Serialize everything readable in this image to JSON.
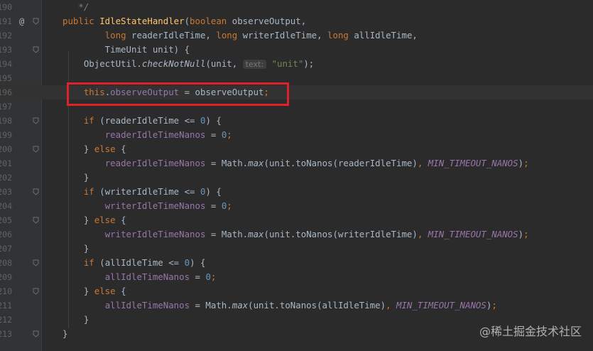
{
  "editor": {
    "lines": [
      {
        "n": "190",
        "code": [
          {
            "t": "   */",
            "c": "cmt"
          }
        ]
      },
      {
        "n": "191",
        "at": "@",
        "code": [
          {
            "t": "public ",
            "c": "kw"
          },
          {
            "t": "IdleStateHandler",
            "c": "fn"
          },
          {
            "t": "("
          },
          {
            "t": "boolean ",
            "c": "kw"
          },
          {
            "t": "observeOutput,"
          }
        ]
      },
      {
        "n": "192",
        "code": [
          {
            "t": "        "
          },
          {
            "t": "long ",
            "c": "kw"
          },
          {
            "t": "readerIdleTime, "
          },
          {
            "t": "long ",
            "c": "kw"
          },
          {
            "t": "writerIdleTime, "
          },
          {
            "t": "long ",
            "c": "kw"
          },
          {
            "t": "allIdleTime,"
          }
        ]
      },
      {
        "n": "193",
        "code": [
          {
            "t": "        TimeUnit unit) {"
          }
        ]
      },
      {
        "n": "194",
        "code": [
          {
            "t": "    ObjectUtil."
          },
          {
            "t": "checkNotNull",
            "c": "itc"
          },
          {
            "t": "(unit, "
          },
          {
            "t": "text:",
            "c": "hint"
          },
          {
            "t": " "
          },
          {
            "t": "\"unit\"",
            "c": "str"
          },
          {
            "t": ");"
          }
        ]
      },
      {
        "n": "195",
        "code": []
      },
      {
        "n": "196",
        "hl": true,
        "code": [
          {
            "t": "    "
          },
          {
            "t": "this",
            "c": "kw"
          },
          {
            "t": "."
          },
          {
            "t": "observeOutput",
            "c": "fld"
          },
          {
            "t": " = observeOutput"
          },
          {
            "t": ";",
            "c": "kw"
          }
        ]
      },
      {
        "n": "197",
        "code": []
      },
      {
        "n": "198",
        "code": [
          {
            "t": "    "
          },
          {
            "t": "if ",
            "c": "kw"
          },
          {
            "t": "(readerIdleTime <= "
          },
          {
            "t": "0",
            "c": "num"
          },
          {
            "t": ") {"
          }
        ]
      },
      {
        "n": "199",
        "code": [
          {
            "t": "        "
          },
          {
            "t": "readerIdleTimeNanos",
            "c": "fld"
          },
          {
            "t": " = "
          },
          {
            "t": "0",
            "c": "num"
          },
          {
            "t": ";",
            "c": "kw"
          }
        ]
      },
      {
        "n": "200",
        "code": [
          {
            "t": "    } "
          },
          {
            "t": "else ",
            "c": "kw"
          },
          {
            "t": "{"
          }
        ]
      },
      {
        "n": "201",
        "code": [
          {
            "t": "        "
          },
          {
            "t": "readerIdleTimeNanos",
            "c": "fld"
          },
          {
            "t": " = Math."
          },
          {
            "t": "max",
            "c": "itc"
          },
          {
            "t": "(unit.toNanos(readerIdleTime)"
          },
          {
            "t": ", ",
            "c": "kw"
          },
          {
            "t": "MIN_TIMEOUT_NANOS",
            "c": "cst"
          },
          {
            "t": ")"
          },
          {
            "t": ";",
            "c": "kw"
          }
        ]
      },
      {
        "n": "202",
        "code": [
          {
            "t": "    }"
          }
        ]
      },
      {
        "n": "203",
        "code": [
          {
            "t": "    "
          },
          {
            "t": "if ",
            "c": "kw"
          },
          {
            "t": "(writerIdleTime <= "
          },
          {
            "t": "0",
            "c": "num"
          },
          {
            "t": ") {"
          }
        ]
      },
      {
        "n": "204",
        "code": [
          {
            "t": "        "
          },
          {
            "t": "writerIdleTimeNanos",
            "c": "fld"
          },
          {
            "t": " = "
          },
          {
            "t": "0",
            "c": "num"
          },
          {
            "t": ";",
            "c": "kw"
          }
        ]
      },
      {
        "n": "205",
        "code": [
          {
            "t": "    } "
          },
          {
            "t": "else ",
            "c": "kw"
          },
          {
            "t": "{"
          }
        ]
      },
      {
        "n": "206",
        "code": [
          {
            "t": "        "
          },
          {
            "t": "writerIdleTimeNanos",
            "c": "fld"
          },
          {
            "t": " = Math."
          },
          {
            "t": "max",
            "c": "itc"
          },
          {
            "t": "(unit.toNanos(writerIdleTime)"
          },
          {
            "t": ", ",
            "c": "kw"
          },
          {
            "t": "MIN_TIMEOUT_NANOS",
            "c": "cst"
          },
          {
            "t": ")"
          },
          {
            "t": ";",
            "c": "kw"
          }
        ]
      },
      {
        "n": "207",
        "code": [
          {
            "t": "    }"
          }
        ]
      },
      {
        "n": "208",
        "code": [
          {
            "t": "    "
          },
          {
            "t": "if ",
            "c": "kw"
          },
          {
            "t": "(allIdleTime <= "
          },
          {
            "t": "0",
            "c": "num"
          },
          {
            "t": ") {"
          }
        ]
      },
      {
        "n": "209",
        "code": [
          {
            "t": "        "
          },
          {
            "t": "allIdleTimeNanos",
            "c": "fld"
          },
          {
            "t": " = "
          },
          {
            "t": "0",
            "c": "num"
          },
          {
            "t": ";",
            "c": "kw"
          }
        ]
      },
      {
        "n": "210",
        "code": [
          {
            "t": "    } "
          },
          {
            "t": "else ",
            "c": "kw"
          },
          {
            "t": "{"
          }
        ]
      },
      {
        "n": "211",
        "code": [
          {
            "t": "        "
          },
          {
            "t": "allIdleTimeNanos",
            "c": "fld"
          },
          {
            "t": " = Math."
          },
          {
            "t": "max",
            "c": "itc"
          },
          {
            "t": "(unit.toNanos(allIdleTime)"
          },
          {
            "t": ", ",
            "c": "kw"
          },
          {
            "t": "MIN_TIMEOUT_NANOS",
            "c": "cst"
          },
          {
            "t": ")"
          },
          {
            "t": ";",
            "c": "kw"
          }
        ]
      },
      {
        "n": "212",
        "code": [
          {
            "t": "    }"
          }
        ]
      },
      {
        "n": "213",
        "code": [
          {
            "t": "}"
          }
        ]
      }
    ]
  },
  "watermark": "@稀土掘金技术社区",
  "colors": {
    "background": "#2b2b2b",
    "keyword": "#cc7832",
    "method": "#ffc66d",
    "field": "#9876aa",
    "number": "#6897bb",
    "string": "#6a8759",
    "highlight_box": "#e0202a"
  }
}
